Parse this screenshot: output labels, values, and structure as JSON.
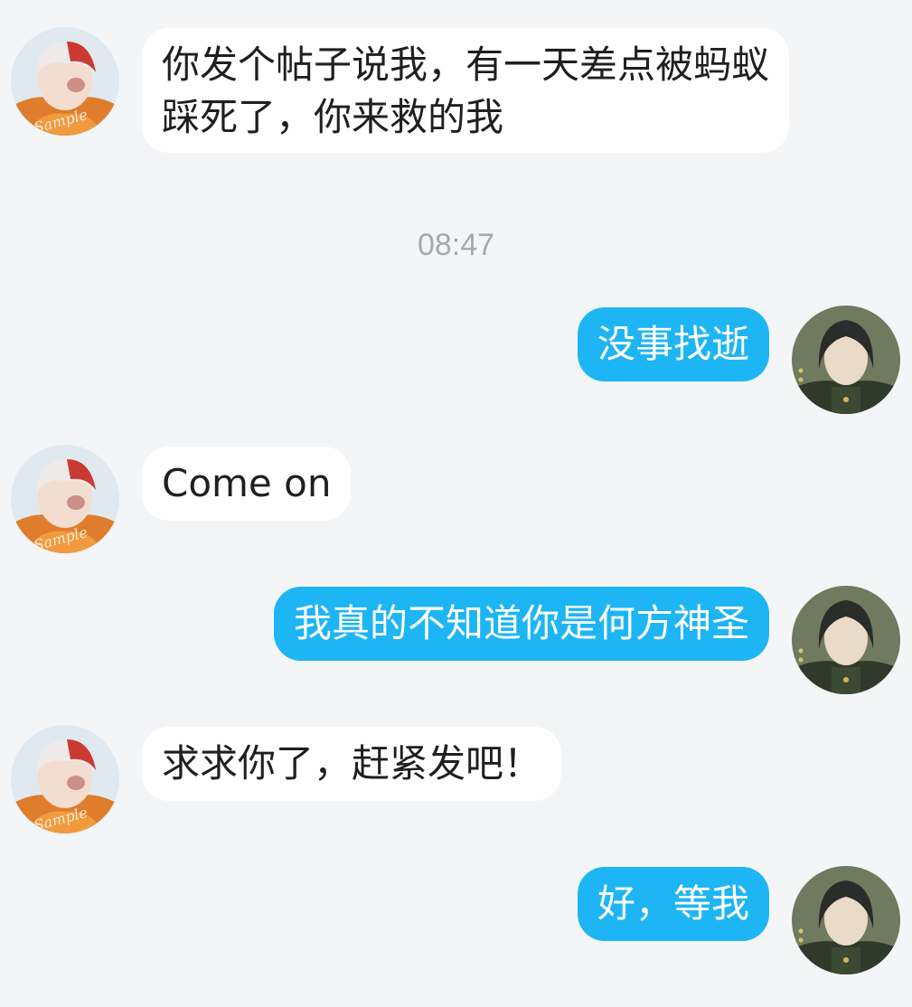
{
  "timestamp": "08:47",
  "messages": [
    {
      "side": "in",
      "text": "你发个帖子说我，有一天差点被蚂蚁踩死了，你来救的我"
    },
    {
      "side": "out",
      "text": "没事找逝"
    },
    {
      "side": "in",
      "text": "Come on"
    },
    {
      "side": "out",
      "text": "我真的不知道你是何方神圣"
    },
    {
      "side": "in",
      "text": "求求你了，赶紧发吧！"
    },
    {
      "side": "out",
      "text": "好，等我"
    }
  ],
  "avatars": {
    "left_watermark": "Sample"
  },
  "colors": {
    "background": "#f4f5f7",
    "incoming_bubble": "#ffffff",
    "outgoing_bubble": "#1eb5f5",
    "timestamp_text": "#a6a8ab"
  }
}
